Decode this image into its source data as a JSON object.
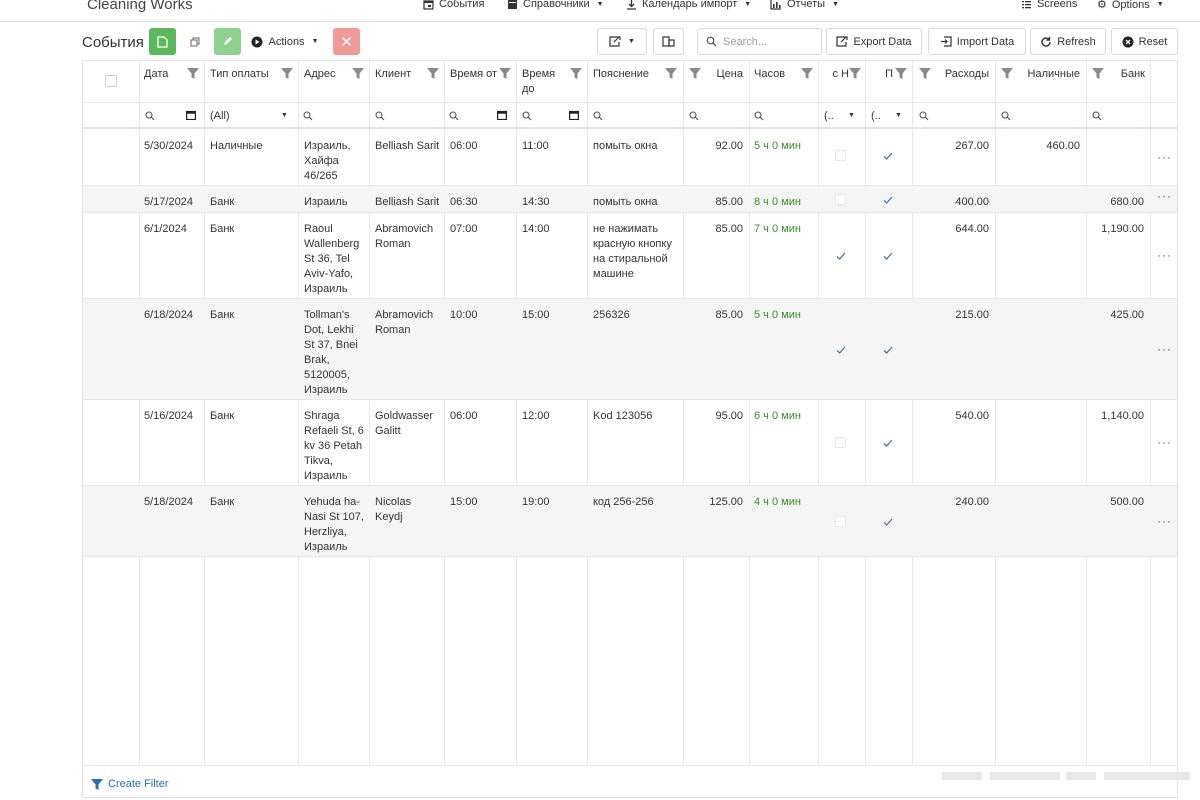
{
  "app": {
    "title": "Cleaning Works",
    "menu": [
      {
        "label": "События",
        "icon": "calendar-icon"
      },
      {
        "label": "Справочники",
        "icon": "book-icon"
      },
      {
        "label": "Календарь импорт",
        "icon": "download-icon"
      },
      {
        "label": "Отчеты",
        "icon": "chart-icon"
      },
      {
        "label": "Screens",
        "icon": "list-icon"
      },
      {
        "label": "Options",
        "icon": "gear-icon"
      }
    ]
  },
  "toolbar": {
    "title": "События",
    "actions_label": "Actions",
    "search_placeholder": "Search...",
    "export_label": "Export Data",
    "import_label": "Import Data",
    "refresh_label": "Refresh",
    "reset_label": "Reset"
  },
  "columns": {
    "date": "Дата",
    "pay": "Тип оплаты",
    "addr": "Адрес",
    "client": "Клиент",
    "from": "Время от",
    "to": "Время до",
    "note": "Пояснение",
    "price": "Цена",
    "hours": "Часов",
    "c_n": "с Н",
    "p": "П",
    "exp": "Расходы",
    "cash": "Наличные",
    "bank": "Банк"
  },
  "filters": {
    "pay": "(All)",
    "c_n": "(..",
    "p": "(.."
  },
  "rows": [
    {
      "date": "5/30/2024",
      "pay": "Наличные",
      "addr": "Израиль, Хайфа 46/265",
      "client": "Belliash Sarit",
      "from": "06:00",
      "to": "11:00",
      "note": "помыть окна",
      "price": "92.00",
      "hours": "5 ч 0 мин",
      "cn": false,
      "p": true,
      "exp": "267.00",
      "cash": "460.00",
      "bank": ""
    },
    {
      "date": "5/17/2024",
      "pay": "Банк",
      "addr": "Израиль",
      "client": "Belliash Sarit",
      "from": "06:30",
      "to": "14:30",
      "note": "помыть окна",
      "price": "85.00",
      "hours": "8 ч 0 мин",
      "cn": false,
      "p": true,
      "exp": "400.00",
      "cash": "",
      "bank": "680.00"
    },
    {
      "date": "6/1/2024",
      "pay": "Банк",
      "addr": "Raoul Wallenberg St 36, Tel Aviv-Yafo, Израиль",
      "client": "Abramovich Roman",
      "from": "07:00",
      "to": "14:00",
      "note": "не нажимать красную кнопку на стиральной машине",
      "price": "85.00",
      "hours": "7 ч 0 мин",
      "cn": true,
      "p": true,
      "exp": "644.00",
      "cash": "",
      "bank": "1,190.00"
    },
    {
      "date": "6/18/2024",
      "pay": "Банк",
      "addr": "Tollman's Dot, Lekhi St 37, Bnei Brak, 5120005, Израиль",
      "client": "Abramovich Roman",
      "from": "10:00",
      "to": "15:00",
      "note": "256326",
      "price": "85.00",
      "hours": "5 ч 0 мин",
      "cn": true,
      "p": true,
      "exp": "215.00",
      "cash": "",
      "bank": "425.00"
    },
    {
      "date": "5/16/2024",
      "pay": "Банк",
      "addr": "Shraga Refaeli St, 6 kv 36 Petah Tikva, Израиль",
      "client": "Goldwasser Galitt",
      "from": "06:00",
      "to": "12:00",
      "note": "Kod 123056",
      "price": "95.00",
      "hours": "6 ч 0 мин",
      "cn": false,
      "p": true,
      "exp": "540.00",
      "cash": "",
      "bank": "1,140.00"
    },
    {
      "date": "5/18/2024",
      "pay": "Банк",
      "addr": "Yehuda ha-Nasi St 107, Herzliya, Израиль",
      "client": "Nicolas Keydj",
      "from": "15:00",
      "to": "19:00",
      "note": "код 256-256",
      "price": "125.00",
      "hours": "4 ч 0 мин",
      "cn": false,
      "p": true,
      "exp": "240.00",
      "cash": "",
      "bank": "500.00"
    }
  ],
  "footer": {
    "create_filter": "Create Filter"
  }
}
